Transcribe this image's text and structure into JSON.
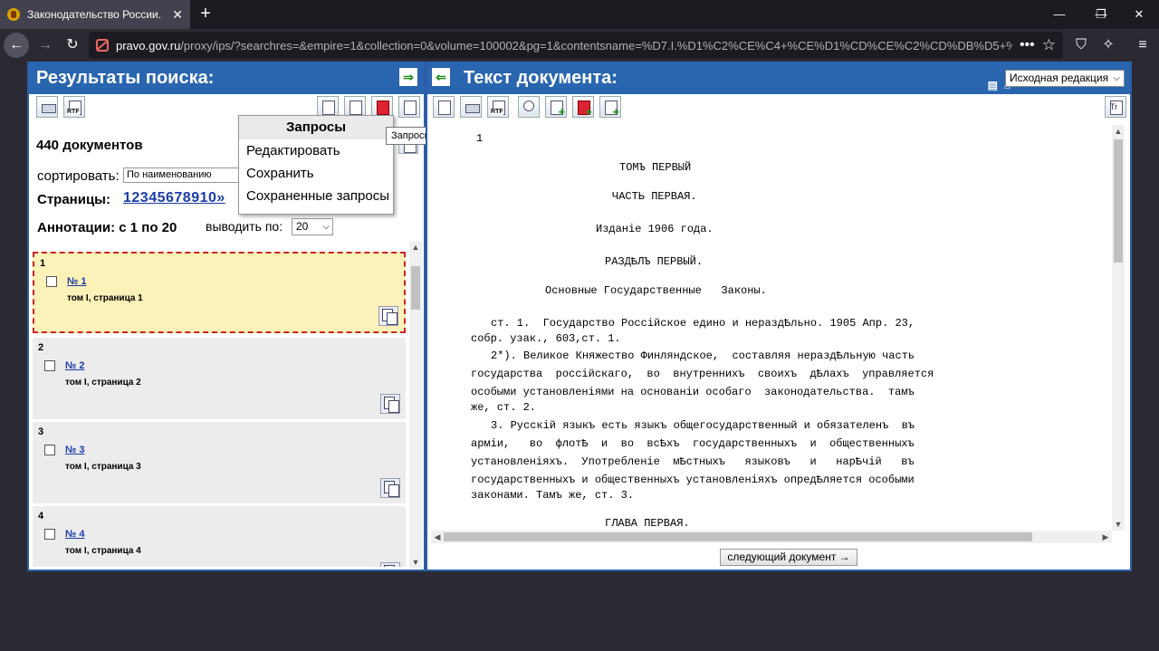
{
  "browser": {
    "tab_title": "Законодательство России.",
    "tab_close": "✕",
    "new_tab": "+",
    "window_controls": [
      "—",
      "❐",
      "✕"
    ],
    "url_domain": "pravo.gov.ru",
    "url_rest": "/proxy/ips/?searchres=&empire=1&collection=0&volume=100002&pg=1&contentsname=%D7.I.%D1%C2%CE%C4+%CE%D1%CD%CE%C2%CD%DB%D5+%",
    "url_dots": "•••"
  },
  "left": {
    "header_title": "Результаты поиска:",
    "collapse_glyph": "⇒",
    "doc_count": "440 документов",
    "sort_label": "сортировать:",
    "sort_value": "По наименованию",
    "pages_label": "Страницы:",
    "pages_links": "12345678910»",
    "annot_label": "Аннотации: с 1 по 20",
    "per_label": "выводить по:",
    "per_value": "20",
    "results": [
      {
        "num": "1",
        "link": "№ 1",
        "sub": "том I, страница 1"
      },
      {
        "num": "2",
        "link": "№ 2",
        "sub": "том I, страница 2"
      },
      {
        "num": "3",
        "link": "№ 3",
        "sub": "том I, страница 3"
      },
      {
        "num": "4",
        "link": "№ 4",
        "sub": "том I, страница 4"
      }
    ]
  },
  "dropdown": {
    "title": "Запросы",
    "items": [
      "Редактировать",
      "Сохранить",
      "Сохраненные запросы"
    ],
    "tooltip": "Запросы"
  },
  "right": {
    "header_title": "Текст документа:",
    "expand_glyph": "⇐",
    "redaction_value": "Исходная редакция",
    "next_button": "следующий документ →",
    "lines": [
      "1",
      "ТОМЪ ПЕРВЫЙ",
      "ЧАСТЬ ПЕРВАЯ.",
      "Изданiе 1906 года.",
      "РАЗДѢЛЪ ПЕРВЫЙ.",
      "Основные Государственные   Законы.",
      "ст. 1.  Государство Россiйское едино и нераздѢльно. 1905 Апр. 23,",
      "собр. узак., 603,ст. 1.",
      "2*). Великое Княжество Финляндское,  составляя нераздѢльную часть",
      "государства  россiйскаго,  во  внутреннихъ  своихъ  дѢлахъ  управляется",
      "особыми установленiями на основанiи особаго  законодательства.  тамъ",
      "же, ст. 2.",
      "3. Русскiй языкъ есть языкъ общегосударственный и обязателенъ  въ",
      "армiи,   во  флотѢ  и  во  всѢхъ  государственныхъ  и  общественныхъ",
      "установленiяхъ.  Употребленiе  мѢстныхъ   языковъ   и   нарѢчiй   въ",
      "государственныхъ и общественныхъ установленiяхъ опредѢляется особыми",
      "законами. Тамъ же, ст. 3.",
      "ГЛАВА ПЕРВАЯ."
    ]
  },
  "colors": {
    "header_blue": "#2a66b0",
    "selected_item_bg": "#fcf1b8",
    "selected_border": "#cc2222",
    "link_blue": "#1a3ca8"
  }
}
